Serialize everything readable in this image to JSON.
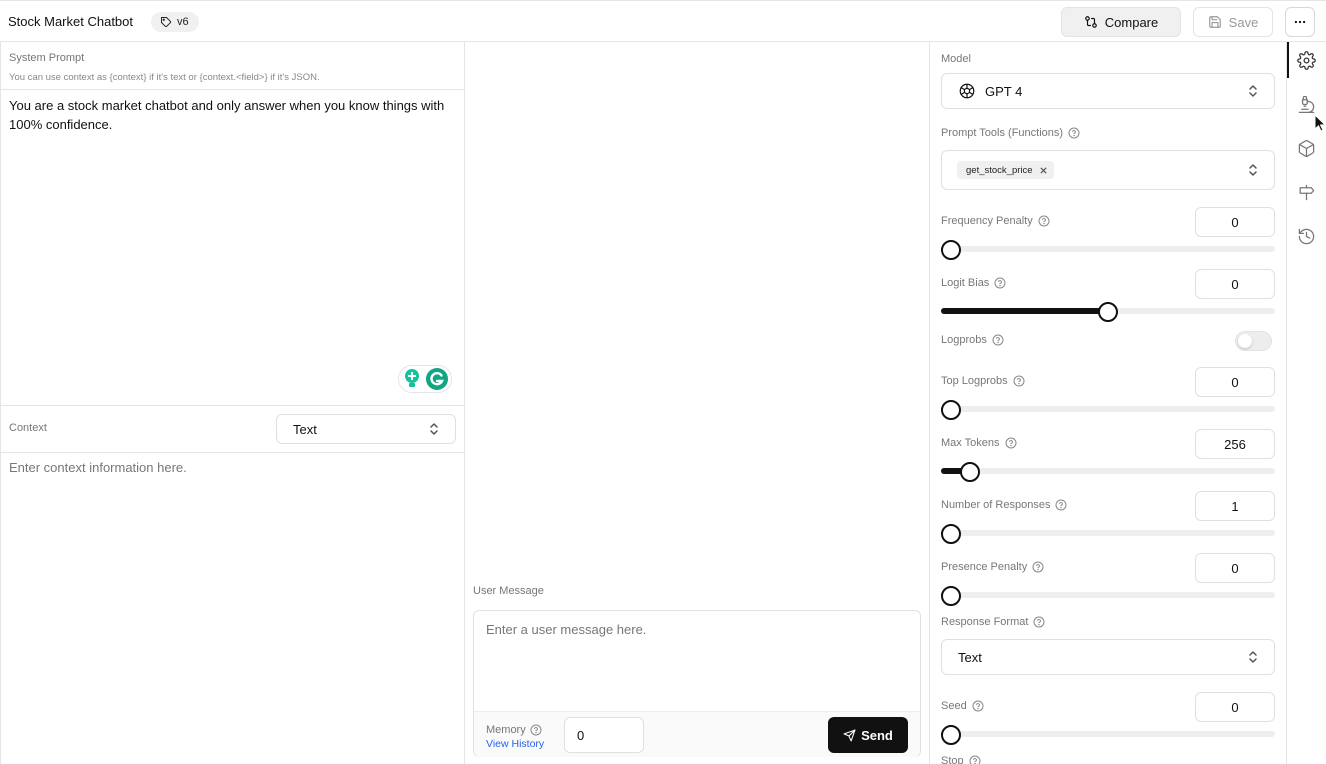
{
  "header": {
    "title": "Stock Market Chatbot",
    "version": "v6",
    "compare_label": "Compare",
    "save_label": "Save"
  },
  "system_prompt": {
    "label": "System Prompt",
    "hint": "You can use context as {context} if it's text or {context.<field>} if it's JSON.",
    "text": "You are a stock market chatbot and only answer when you know things with 100% confidence."
  },
  "context": {
    "label": "Context",
    "type_value": "Text",
    "placeholder": "Enter context information here."
  },
  "user_message": {
    "label": "User Message",
    "placeholder": "Enter a user message here.",
    "memory_label": "Memory",
    "view_history_label": "View History",
    "memory_value": "0",
    "send_label": "Send"
  },
  "settings": {
    "model_label": "Model",
    "model_value": "GPT 4",
    "tools_label": "Prompt Tools (Functions)",
    "tools": [
      "get_stock_price"
    ],
    "frequency_penalty": {
      "label": "Frequency Penalty",
      "value": "0",
      "level": 0
    },
    "logit_bias": {
      "label": "Logit Bias",
      "value": "0",
      "level": 0.5
    },
    "logprobs": {
      "label": "Logprobs",
      "on": false
    },
    "top_logprobs": {
      "label": "Top Logprobs",
      "value": "0",
      "level": 0
    },
    "max_tokens": {
      "label": "Max Tokens",
      "value": "256",
      "level": 0.06
    },
    "number_of_responses": {
      "label": "Number of Responses",
      "value": "1",
      "level": 0
    },
    "presence_penalty": {
      "label": "Presence Penalty",
      "value": "0",
      "level": 0
    },
    "response_format": {
      "label": "Response Format",
      "value": "Text"
    },
    "seed": {
      "label": "Seed",
      "value": "0",
      "level": 0
    },
    "stop_label": "Stop"
  },
  "rail": {
    "items": [
      "gear-icon",
      "flask-icon",
      "cube-icon",
      "signpost-icon",
      "history-icon"
    ],
    "active_index": 0
  },
  "colors": {
    "accent": "#111111",
    "link": "#2563eb",
    "border": "#e5e5e5"
  }
}
